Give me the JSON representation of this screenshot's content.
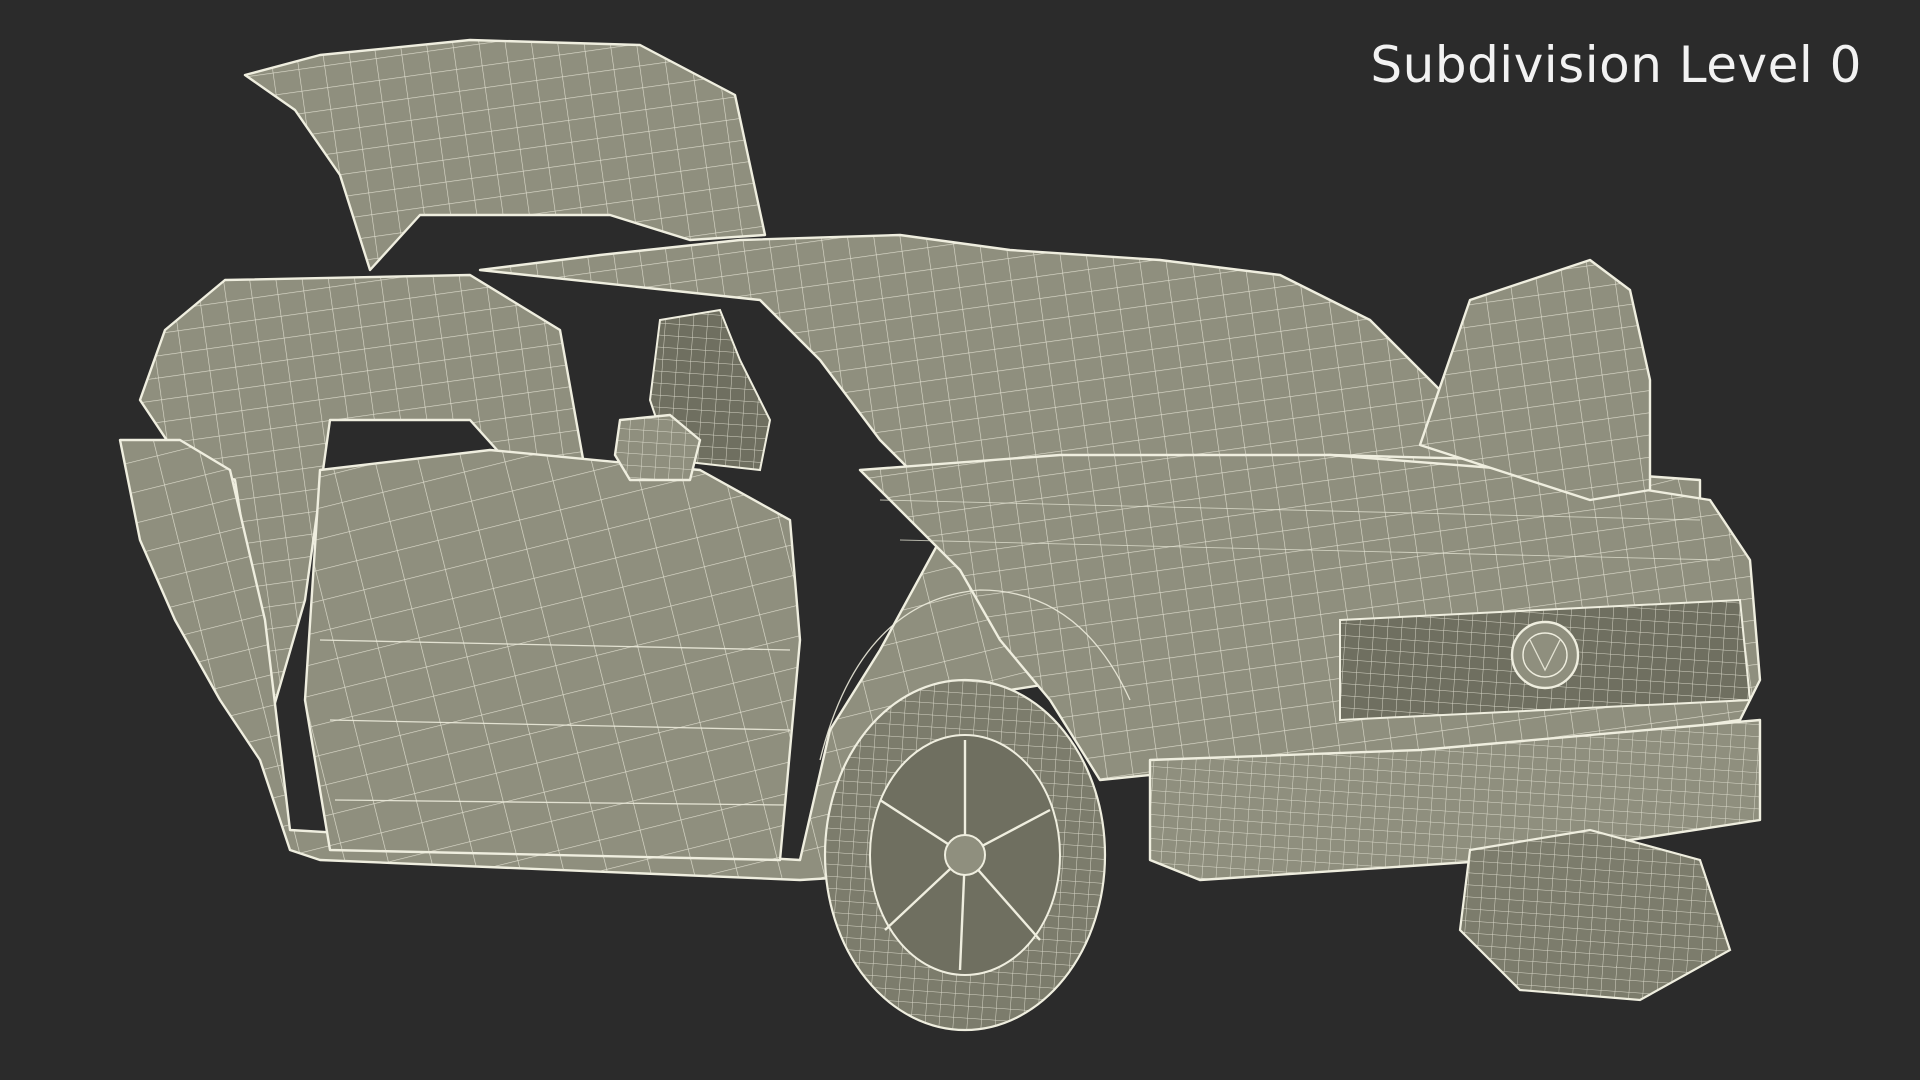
{
  "overlay": {
    "label": "Subdivision Level 0"
  },
  "scene": {
    "subject": "wireframe-car",
    "background_color": "#2b2b2b",
    "mesh_fill_color": "#8f8f7e",
    "wire_color": "#efeedf",
    "label_color": "#f2f2f2"
  }
}
